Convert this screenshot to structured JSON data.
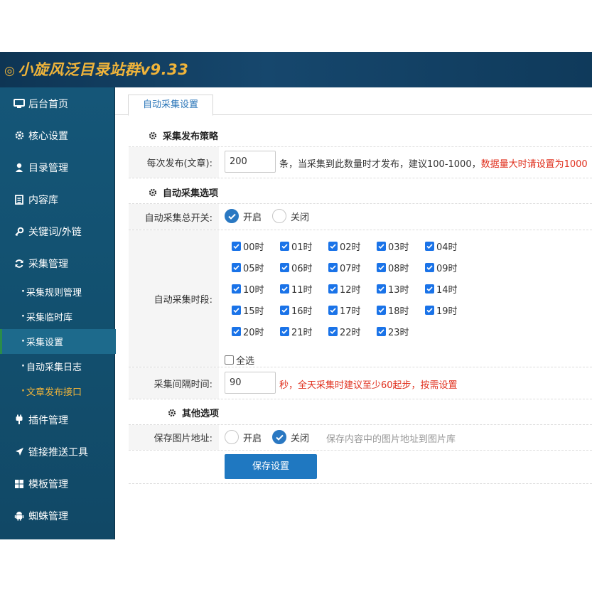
{
  "app": {
    "title": "小旋风泛目录站群v9.33",
    "logo_color": "#f0b43a"
  },
  "sidebar": {
    "items": [
      {
        "label": "后台首页",
        "icon": "monitor-icon"
      },
      {
        "label": "核心设置",
        "icon": "gear-icon"
      },
      {
        "label": "目录管理",
        "icon": "user-icon"
      },
      {
        "label": "内容库",
        "icon": "document-icon"
      },
      {
        "label": "关键词/外链",
        "icon": "key-icon"
      },
      {
        "label": "采集管理",
        "icon": "refresh-icon"
      },
      {
        "label": "插件管理",
        "icon": "plug-icon"
      },
      {
        "label": "链接推送工具",
        "icon": "send-icon"
      },
      {
        "label": "模板管理",
        "icon": "windows-icon"
      },
      {
        "label": "蜘蛛管理",
        "icon": "android-icon"
      }
    ],
    "sub_items": [
      {
        "label": "采集规则管理"
      },
      {
        "label": "采集临时库"
      },
      {
        "label": "采集设置",
        "active": true
      },
      {
        "label": "自动采集日志"
      },
      {
        "label": "文章发布接口",
        "highlight": true
      }
    ]
  },
  "tabs": [
    {
      "label": "自动采集设置"
    }
  ],
  "sections": {
    "publish": "采集发布策略",
    "auto": "自动采集选项",
    "other": "其他选项"
  },
  "form": {
    "publish_label": "每次发布(文章):",
    "publish_value": "200",
    "publish_note": "条，当采集到此数量时才发布，建议100-1000，",
    "publish_note_red": "数据量大时请设置为1000",
    "switch_label": "自动采集总开关:",
    "switch_on": "开启",
    "switch_off": "关闭",
    "switch_value": "on",
    "hours_label": "自动采集时段:",
    "hours": [
      "00时",
      "01时",
      "02时",
      "03时",
      "04时",
      "05时",
      "06时",
      "07时",
      "08时",
      "09时",
      "10时",
      "11时",
      "12时",
      "13时",
      "14时",
      "15时",
      "16时",
      "17时",
      "18时",
      "19时",
      "20时",
      "21时",
      "22时",
      "23时"
    ],
    "select_all": "全选",
    "interval_label": "采集间隔时间:",
    "interval_value": "90",
    "interval_note": "秒，全天采集时建议至少60起步，按需设置",
    "save_img_label": "保存图片地址:",
    "save_img_on": "开启",
    "save_img_off": "关闭",
    "save_img_value": "off",
    "save_img_hint": "保存内容中的图片地址到图片库",
    "save_button": "保存设置"
  },
  "colors": {
    "accent": "#1f78c1",
    "warning": "#e0301e",
    "sidebar": "#155678"
  }
}
